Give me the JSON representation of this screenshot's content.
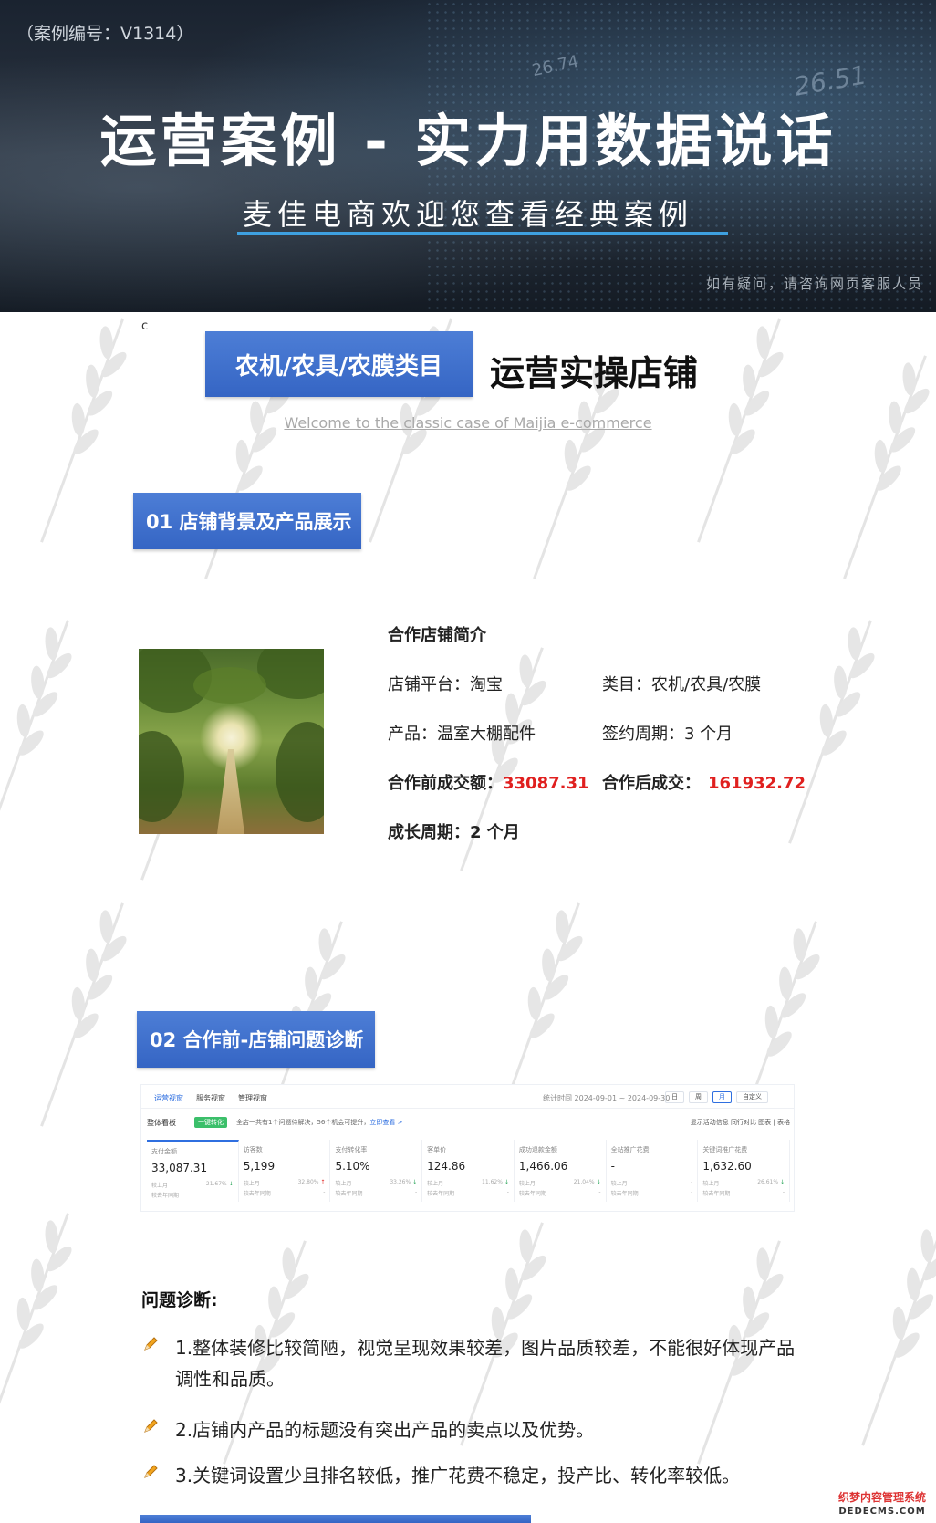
{
  "banner": {
    "case_no": "（案例编号：V1314）",
    "title": "运营案例 - 实力用数据说话",
    "subtitle": "麦佳电商欢迎您查看经典案例",
    "contact": "如有疑问，请咨询网页客服人员",
    "deco_num_1": "26.74",
    "deco_num_2": "26.51"
  },
  "stray_char": "c",
  "category": {
    "label": "农机/农具/农膜类目",
    "right": "运营实操店铺",
    "welcome": "Welcome to the classic case of Maijia e-commerce"
  },
  "section1": {
    "title": "01 店铺背景及产品展示",
    "info_title": "合作店铺简介",
    "platform": "店铺平台：淘宝",
    "category": "类目：农机/农具/农膜",
    "product": "产品：温室大棚配件",
    "period": "签约周期：3 个月",
    "before_label": "合作前成交额：",
    "before_value": "33087.31",
    "after_label": "合作后成交：",
    "after_value": "161932.72",
    "growth": "成长周期：2 个月"
  },
  "section2": {
    "title": "02 合作前-店铺问题诊断",
    "dashboard": {
      "tabs": [
        "运营视窗",
        "服务视窗",
        "管理视窗"
      ],
      "period": "统计时间 2024-09-01 ~ 2024-09-30",
      "pills": [
        "日",
        "周",
        "月",
        "自定义"
      ],
      "board": "整体看板",
      "badge": "一键转化",
      "notice": "全店一共有1个问题待解决，56个机会可提升，",
      "notice_link": "立即查看 >",
      "opts": "显示活动信息  同行对比  图表 | 表格",
      "cmp_label_1": "较上月",
      "cmp_label_2": "较去年同期",
      "metrics": [
        {
          "label": "支付金额",
          "value": "33,087.31",
          "cmp": "21.67%",
          "dir": "down"
        },
        {
          "label": "访客数",
          "value": "5,199",
          "cmp": "32.80%",
          "dir": "up"
        },
        {
          "label": "支付转化率",
          "value": "5.10%",
          "cmp": "33.26%",
          "dir": "down"
        },
        {
          "label": "客单价",
          "value": "124.86",
          "cmp": "11.62%",
          "dir": "down"
        },
        {
          "label": "成功退款金额",
          "value": "1,466.06",
          "cmp": "21.04%",
          "dir": "down"
        },
        {
          "label": "全站推广花费",
          "value": "-",
          "cmp": "-",
          "dir": "none"
        },
        {
          "label": "关键词推广花费",
          "value": "1,632.60",
          "cmp": "26.61%",
          "dir": "down"
        }
      ]
    },
    "diag_title": "问题诊断:",
    "issues": [
      "1.整体装修比较简陋，视觉呈现效果较差，图片品质较差，不能很好体现产品调性和品质。",
      "2.店铺内产品的标题没有突出产品的卖点以及优势。",
      "3.关键词设置少且排名较低，推广花费不稳定，投产比、转化率较低。"
    ]
  },
  "corner_logo": {
    "line1": "织梦内容管理系统",
    "line2": "DEDECMS.COM"
  },
  "colors": {
    "accent_blue": "#3565c4",
    "highlight_red": "#e0201f",
    "underline_blue": "#3ea0e0"
  }
}
